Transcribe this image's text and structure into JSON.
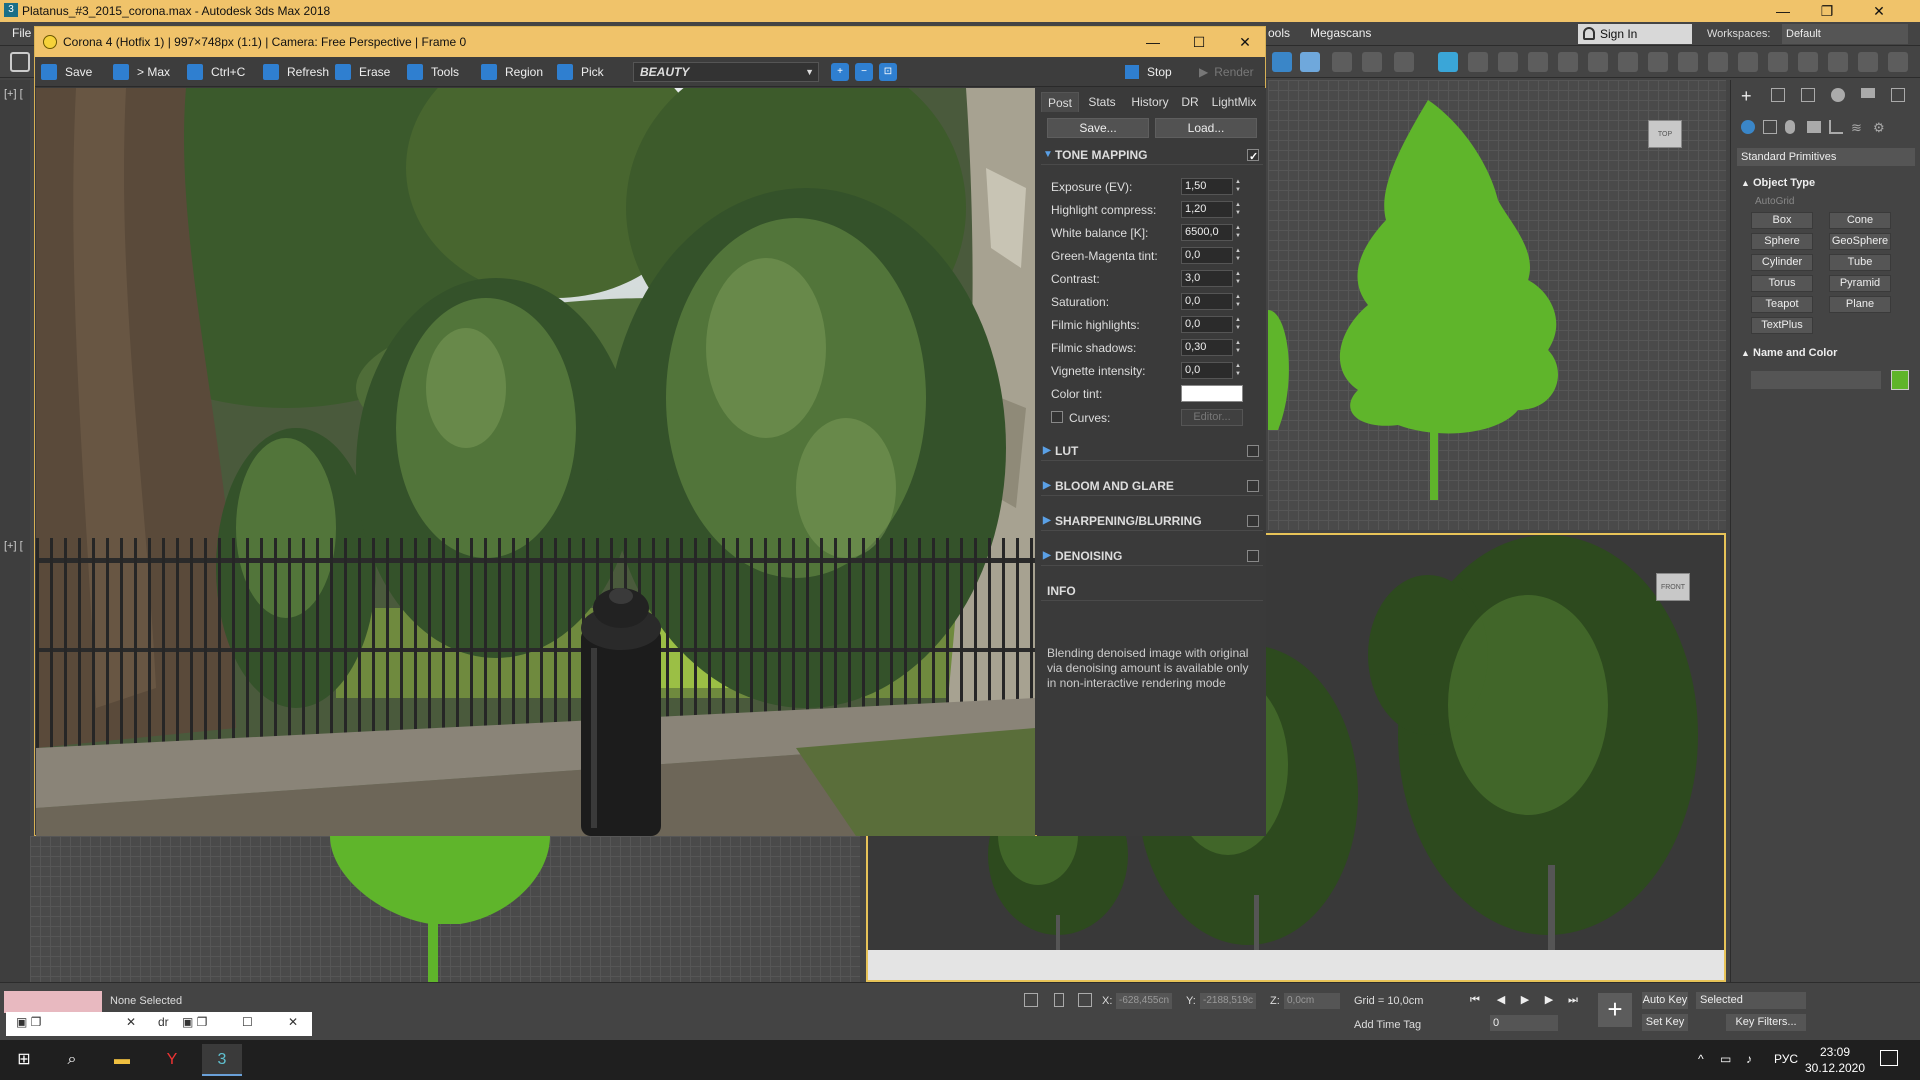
{
  "max": {
    "title": "Platanus_#3_2015_corona.max - Autodesk 3ds Max 2018",
    "menu": {
      "file": "File",
      "tools_partial": "ools",
      "megascans": "Megascans"
    },
    "sign_in": "Sign In",
    "workspaces_label": "Workspaces:",
    "workspaces_value": "Default",
    "vp_labels": {
      "top_left": "[+] [",
      "mid_left": "[+] ["
    },
    "viewcube_top": "TOP",
    "viewcube_front": "FRONT"
  },
  "cmd_panel": {
    "primitives_dropdown": "Standard Primitives",
    "object_type": "Object Type",
    "autogrid": "AutoGrid",
    "primitives": [
      "Box",
      "Cone",
      "Sphere",
      "GeoSphere",
      "Cylinder",
      "Tube",
      "Torus",
      "Pyramid",
      "Teapot",
      "Plane",
      "TextPlus"
    ],
    "name_and_color": "Name and Color",
    "object_color": "#5fb52b"
  },
  "vfb": {
    "title": "Corona 4 (Hotfix 1) | 997×748px (1:1) | Camera: Free Perspective | Frame 0",
    "toolbar": {
      "save": "Save",
      "to_max": "> Max",
      "copy": "Ctrl+C",
      "refresh": "Refresh",
      "erase": "Erase",
      "tools": "Tools",
      "region": "Region",
      "pick": "Pick",
      "channel": "BEAUTY",
      "stop": "Stop",
      "render": "Render"
    },
    "post": {
      "tabs": [
        "Post",
        "Stats",
        "History",
        "DR",
        "LightMix"
      ],
      "save_btn": "Save...",
      "load_btn": "Load...",
      "tone_mapping": "TONE MAPPING",
      "params": [
        {
          "label": "Exposure (EV):",
          "value": "1,50"
        },
        {
          "label": "Highlight compress:",
          "value": "1,20"
        },
        {
          "label": "White balance [K]:",
          "value": "6500,0"
        },
        {
          "label": "Green-Magenta tint:",
          "value": "0,0"
        },
        {
          "label": "Contrast:",
          "value": "3,0"
        },
        {
          "label": "Saturation:",
          "value": "0,0"
        },
        {
          "label": "Filmic highlights:",
          "value": "0,0"
        },
        {
          "label": "Filmic shadows:",
          "value": "0,30"
        },
        {
          "label": "Vignette intensity:",
          "value": "0,0"
        }
      ],
      "color_tint_label": "Color tint:",
      "color_tint": "#ffffff",
      "curves_label": "Curves:",
      "curves_editor": "Editor...",
      "lut": "LUT",
      "bloom": "BLOOM AND GLARE",
      "sharpen": "SHARPENING/BLURRING",
      "denoise": "DENOISING",
      "info": "INFO",
      "info_text": "Blending denoised image with original via denoising amount is available only in non-interactive rendering mode"
    }
  },
  "status": {
    "none_selected": "None Selected",
    "x_label": "X:",
    "x_value": "-628,455cn",
    "y_label": "Y:",
    "y_value": "-2188,519c",
    "z_label": "Z:",
    "z_value": "0,0cm",
    "grid": "Grid = 10,0cm",
    "add_time_tag": "Add Time Tag",
    "frame": "0",
    "auto_key": "Auto Key",
    "set_key": "Set Key",
    "selected": "Selected",
    "key_filters": "Key Filters...",
    "mini_partial": "dr"
  },
  "taskbar": {
    "lang": "РУС",
    "time": "23:09",
    "date": "30.12.2020"
  }
}
